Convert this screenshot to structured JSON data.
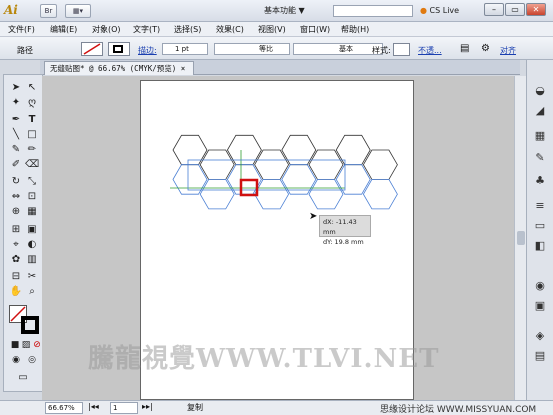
{
  "app": {
    "logo": "Ai",
    "br_label": "Br",
    "workspace": "基本功能",
    "workspace_arrow": "▼",
    "cs_live": "CS Live"
  },
  "window_buttons": {
    "minimize": "–",
    "restore": "▭",
    "close": "✕"
  },
  "menu": [
    "文件(F)",
    "编辑(E)",
    "对象(O)",
    "文字(T)",
    "选择(S)",
    "效果(C)",
    "视图(V)",
    "窗口(W)",
    "帮助(H)"
  ],
  "control": {
    "selection_label": "路径",
    "stroke_label": "描边:",
    "stroke_value": "1 pt",
    "profile_label": "等比",
    "brush_label": "基本",
    "style_label": "样式:",
    "opacity_label": "不透...",
    "align_label": "对齐"
  },
  "document": {
    "tab_title": "无缝贴图* @ 66.67% (CMYK/预览)",
    "tab_close": "×"
  },
  "tooltip": {
    "dx": "dX: -11.43 mm",
    "dy": "dY: 19.8 mm"
  },
  "status": {
    "zoom": "66.67%",
    "page": "1",
    "mode": "复制"
  },
  "watermark": "騰龍視覺WWW.TLVI.NET",
  "credit": "思缘设计论坛 WWW.MISSYUAN.COM",
  "colors": {
    "selection": "#4a7fd4",
    "highlight": "#d01010",
    "guide": "#2f9e2f"
  }
}
